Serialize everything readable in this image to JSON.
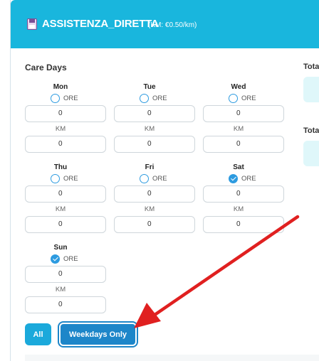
{
  "header": {
    "title": "ASSISTENZA_DIRETTA",
    "subtitle": "(KM: €0.50/km)",
    "icon": "floppy-disk-icon",
    "bg_color": "#19b6dd"
  },
  "care_days_label": "Care Days",
  "right_panel": {
    "label_1": "Tota",
    "label_2": "Tota"
  },
  "days": [
    {
      "name": "Mon",
      "radio_label": "ORE",
      "checked": false,
      "ore_value": "0",
      "km_label": "KM",
      "km_value": "0"
    },
    {
      "name": "Tue",
      "radio_label": "ORE",
      "checked": false,
      "ore_value": "0",
      "km_label": "KM",
      "km_value": "0"
    },
    {
      "name": "Wed",
      "radio_label": "ORE",
      "checked": false,
      "ore_value": "0",
      "km_label": "KM",
      "km_value": "0"
    },
    {
      "name": "Thu",
      "radio_label": "ORE",
      "checked": false,
      "ore_value": "0",
      "km_label": "KM",
      "km_value": "0"
    },
    {
      "name": "Fri",
      "radio_label": "ORE",
      "checked": false,
      "ore_value": "0",
      "km_label": "KM",
      "km_value": "0"
    },
    {
      "name": "Sat",
      "radio_label": "ORE",
      "checked": true,
      "ore_value": "0",
      "km_label": "KM",
      "km_value": "0"
    },
    {
      "name": "Sun",
      "radio_label": "ORE",
      "checked": true,
      "ore_value": "0",
      "km_label": "KM",
      "km_value": "0"
    }
  ],
  "buttons": {
    "all": "All",
    "weekdays_only": "Weekdays Only"
  },
  "annotation": {
    "arrow_color": "#e02020"
  }
}
